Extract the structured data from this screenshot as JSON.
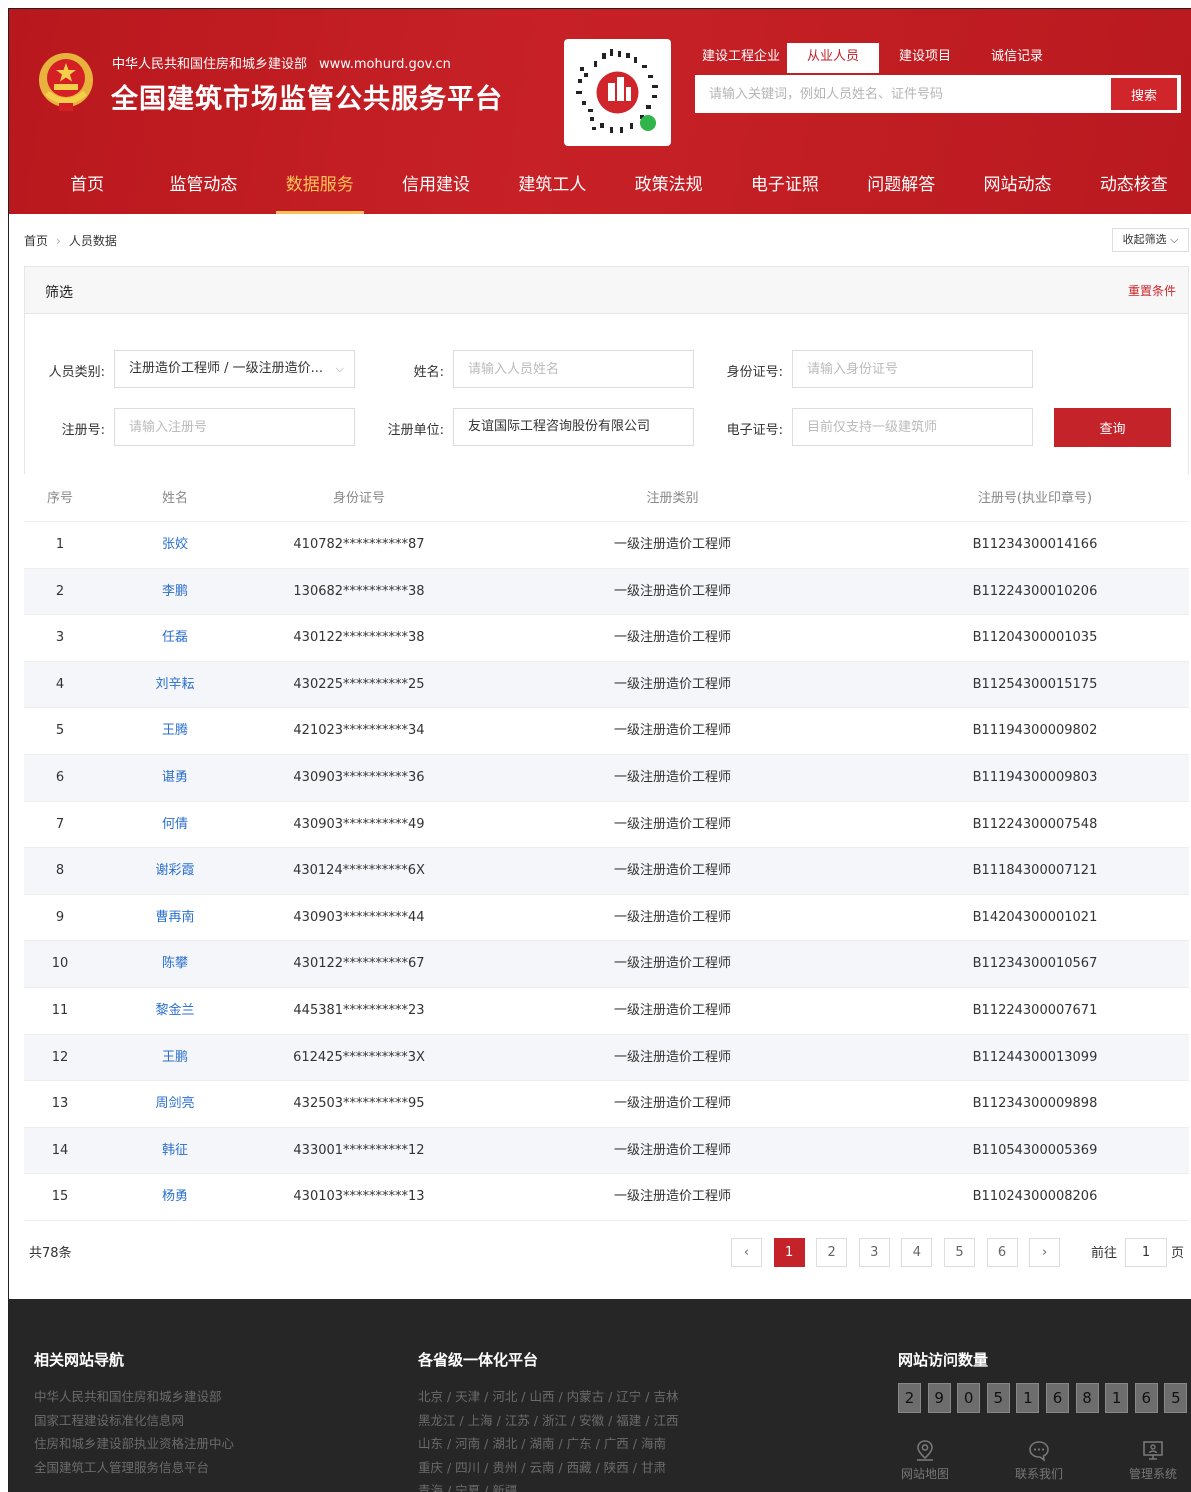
{
  "header": {
    "ministry": "中华人民共和国住房和城乡建设部",
    "url": "www.mohurd.gov.cn",
    "title": "全国建筑市场监管公共服务平台",
    "search_tabs": [
      "建设工程企业",
      "从业人员",
      "建设项目",
      "诚信记录"
    ],
    "active_search_tab": 1,
    "search_placeholder": "请输入关键词，例如人员姓名、证件号码",
    "search_button": "搜索"
  },
  "nav": {
    "items": [
      "首页",
      "监管动态",
      "数据服务",
      "信用建设",
      "建筑工人",
      "政策法规",
      "电子证照",
      "问题解答",
      "网站动态",
      "动态核查"
    ],
    "active_index": 2
  },
  "breadcrumb": {
    "home": "首页",
    "current": "人员数据"
  },
  "collapse_label": "收起筛选",
  "filter": {
    "title": "筛选",
    "reset": "重置条件",
    "person_type_label": "人员类别:",
    "person_type_value": "注册造价工程师 / 一级注册造价...",
    "name_label": "姓名:",
    "name_placeholder": "请输入人员姓名",
    "id_label": "身份证号:",
    "id_placeholder": "请输入身份证号",
    "reg_no_label": "注册号:",
    "reg_no_placeholder": "请输入注册号",
    "reg_unit_label": "注册单位:",
    "reg_unit_value": "友谊国际工程咨询股份有限公司",
    "e_cert_label": "电子证号:",
    "e_cert_placeholder": "目前仅支持一级建筑师",
    "query_button": "查询"
  },
  "table": {
    "headers": [
      "序号",
      "姓名",
      "身份证号",
      "注册类别",
      "注册号(执业印章号)"
    ],
    "rows": [
      [
        "1",
        "张姣",
        "410782**********87",
        "一级注册造价工程师",
        "B11234300014166"
      ],
      [
        "2",
        "李鹏",
        "130682**********38",
        "一级注册造价工程师",
        "B11224300010206"
      ],
      [
        "3",
        "任磊",
        "430122**********38",
        "一级注册造价工程师",
        "B11204300001035"
      ],
      [
        "4",
        "刘辛耘",
        "430225**********25",
        "一级注册造价工程师",
        "B11254300015175"
      ],
      [
        "5",
        "王腾",
        "421023**********34",
        "一级注册造价工程师",
        "B11194300009802"
      ],
      [
        "6",
        "谌勇",
        "430903**********36",
        "一级注册造价工程师",
        "B11194300009803"
      ],
      [
        "7",
        "何倩",
        "430903**********49",
        "一级注册造价工程师",
        "B11224300007548"
      ],
      [
        "8",
        "谢彩霞",
        "430124**********6X",
        "一级注册造价工程师",
        "B11184300007121"
      ],
      [
        "9",
        "曹再南",
        "430903**********44",
        "一级注册造价工程师",
        "B14204300001021"
      ],
      [
        "10",
        "陈攀",
        "430122**********67",
        "一级注册造价工程师",
        "B11234300010567"
      ],
      [
        "11",
        "黎金兰",
        "445381**********23",
        "一级注册造价工程师",
        "B11224300007671"
      ],
      [
        "12",
        "王鹏",
        "612425**********3X",
        "一级注册造价工程师",
        "B11244300013099"
      ],
      [
        "13",
        "周剑亮",
        "432503**********95",
        "一级注册造价工程师",
        "B11234300009898"
      ],
      [
        "14",
        "韩征",
        "433001**********12",
        "一级注册造价工程师",
        "B11054300005369"
      ],
      [
        "15",
        "杨勇",
        "430103**********13",
        "一级注册造价工程师",
        "B11024300008206"
      ]
    ]
  },
  "pagination": {
    "total": "共78条",
    "prev": "‹",
    "pages": [
      "1",
      "2",
      "3",
      "4",
      "5",
      "6"
    ],
    "active_page": 0,
    "next": "›",
    "goto_label": "前往",
    "goto_value": "1",
    "goto_suffix": "页"
  },
  "footer": {
    "nav_title": "相关网站导航",
    "nav_links": [
      "中华人民共和国住房和城乡建设部",
      "国家工程建设标准化信息网",
      "住房和城乡建设部执业资格注册中心",
      "全国建筑工人管理服务信息平台"
    ],
    "provinces_title": "各省级一体化平台",
    "province_lines": [
      "北京 / 天津 / 河北 / 山西 / 内蒙古 / 辽宁 / 吉林",
      "黑龙江 / 上海 / 江苏 / 浙江 / 安徽 / 福建 / 江西",
      "山东 / 河南 / 湖北 / 湖南 / 广东 / 广西 / 海南",
      "重庆 / 四川 / 贵州 / 云南 / 西藏 / 陕西 / 甘肃",
      "青海 / 宁夏 / 新疆"
    ],
    "visits_title": "网站访问数量",
    "visit_digits": [
      "2",
      "9",
      "0",
      "5",
      "1",
      "6",
      "8",
      "1",
      "6",
      "5"
    ],
    "tools": [
      {
        "label": "网站地图",
        "icon": "map-pin-icon"
      },
      {
        "label": "联系我们",
        "icon": "chat-bubble-icon"
      },
      {
        "label": "管理系统",
        "icon": "monitor-user-icon"
      }
    ]
  },
  "colors": {
    "brand_red": "#c5232a",
    "nav_active": "#ffc25a",
    "link_blue": "#2b6fcf",
    "footer_bg": "#262626"
  }
}
